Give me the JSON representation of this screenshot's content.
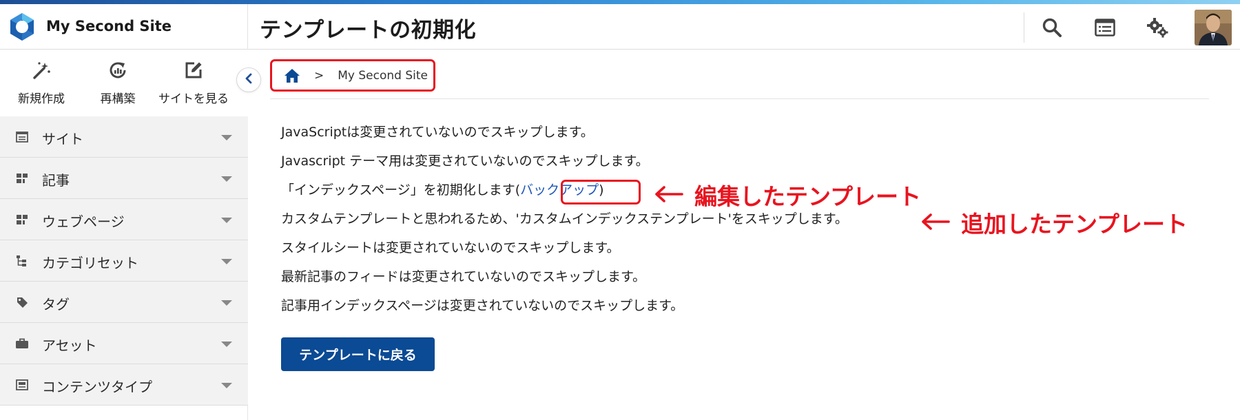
{
  "header": {
    "site_name": "My Second Site",
    "page_title": "テンプレートの初期化",
    "icons": [
      "search-icon",
      "list-window-icon",
      "gear-icon"
    ]
  },
  "quick_actions": [
    {
      "icon": "wand-icon",
      "label": "新規作成"
    },
    {
      "icon": "rebuild-icon",
      "label": "再構築"
    },
    {
      "icon": "edit-external-icon",
      "label": "サイトを見る"
    }
  ],
  "sidebar": {
    "items": [
      {
        "icon": "site-icon",
        "label": "サイト"
      },
      {
        "icon": "entry-icon",
        "label": "記事"
      },
      {
        "icon": "page-icon",
        "label": "ウェブページ"
      },
      {
        "icon": "category-icon",
        "label": "カテゴリセット"
      },
      {
        "icon": "tag-icon",
        "label": "タグ"
      },
      {
        "icon": "asset-icon",
        "label": "アセット"
      },
      {
        "icon": "content-type-icon",
        "label": "コンテンツタイプ"
      }
    ]
  },
  "breadcrumb": {
    "separator": ">",
    "site": "My Second Site"
  },
  "messages": {
    "m1": "JavaScriptは変更されていないのでスキップします。",
    "m2": "Javascript テーマ用は変更されていないのでスキップします。",
    "m3_prefix": "「インデックスページ」を初期化します(",
    "m3_link": "バックアップ",
    "m3_suffix": ")",
    "m4": "カスタムテンプレートと思われるため、'カスタムインデックステンプレート'をスキップします。",
    "m5": "スタイルシートは変更されていないのでスキップします。",
    "m6": "最新記事のフィードは変更されていないのでスキップします。",
    "m7": "記事用インデックスページは変更されていないのでスキップします。"
  },
  "annotations": {
    "edited": "編集したテンプレート",
    "added": "追加したテンプレート",
    "color": "#e8141f"
  },
  "back_button": "テンプレートに戻る",
  "colors": {
    "primary": "#0b4a94",
    "link": "#1f56b8",
    "highlight": "#e8141f"
  }
}
